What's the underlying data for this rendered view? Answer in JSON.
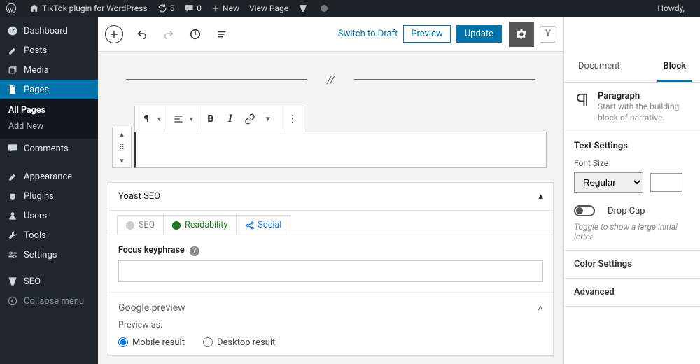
{
  "adminbar": {
    "site_title": "TikTok plugin for WordPress",
    "refresh_count": "5",
    "comment_count": "0",
    "new_label": "New",
    "view_page_label": "View Page",
    "howdy_label": "Howdy,"
  },
  "sidebar": {
    "items": [
      {
        "icon": "dashboard",
        "label": "Dashboard"
      },
      {
        "icon": "pin",
        "label": "Posts"
      },
      {
        "icon": "media",
        "label": "Media"
      },
      {
        "icon": "page",
        "label": "Pages",
        "current": true
      },
      {
        "icon": "comment",
        "label": "Comments"
      },
      {
        "icon": "brush",
        "label": "Appearance"
      },
      {
        "icon": "plug",
        "label": "Plugins"
      },
      {
        "icon": "user",
        "label": "Users"
      },
      {
        "icon": "wrench",
        "label": "Tools"
      },
      {
        "icon": "sliders",
        "label": "Settings"
      },
      {
        "icon": "yoast",
        "label": "SEO"
      },
      {
        "icon": "collapse",
        "label": "Collapse menu"
      }
    ],
    "submenu": {
      "all_pages": "All Pages",
      "add_new": "Add New"
    }
  },
  "editorbar": {
    "switch_to_draft": "Switch to Draft",
    "preview": "Preview",
    "update": "Update"
  },
  "separator": {
    "glyph": "//"
  },
  "toolbar": {
    "b": "B",
    "i": "I"
  },
  "yoast": {
    "title": "Yoast SEO",
    "tabs": {
      "seo": "SEO",
      "readability": "Readability",
      "social": "Social"
    },
    "focus_label": "Focus keyphrase",
    "google_preview": "Google preview",
    "preview_as": "Preview as:",
    "radio_mobile": "Mobile result",
    "radio_desktop": "Desktop result"
  },
  "inspector": {
    "tab_document": "Document",
    "tab_block": "Block",
    "block_title": "Paragraph",
    "block_desc": "Start with the building block of narrative.",
    "text_settings": "Text Settings",
    "font_size_label": "Font Size",
    "font_size_value": "Regular",
    "drop_cap": "Drop Cap",
    "drop_cap_hint": "Toggle to show a large initial letter.",
    "color_settings": "Color Settings",
    "advanced": "Advanced"
  }
}
